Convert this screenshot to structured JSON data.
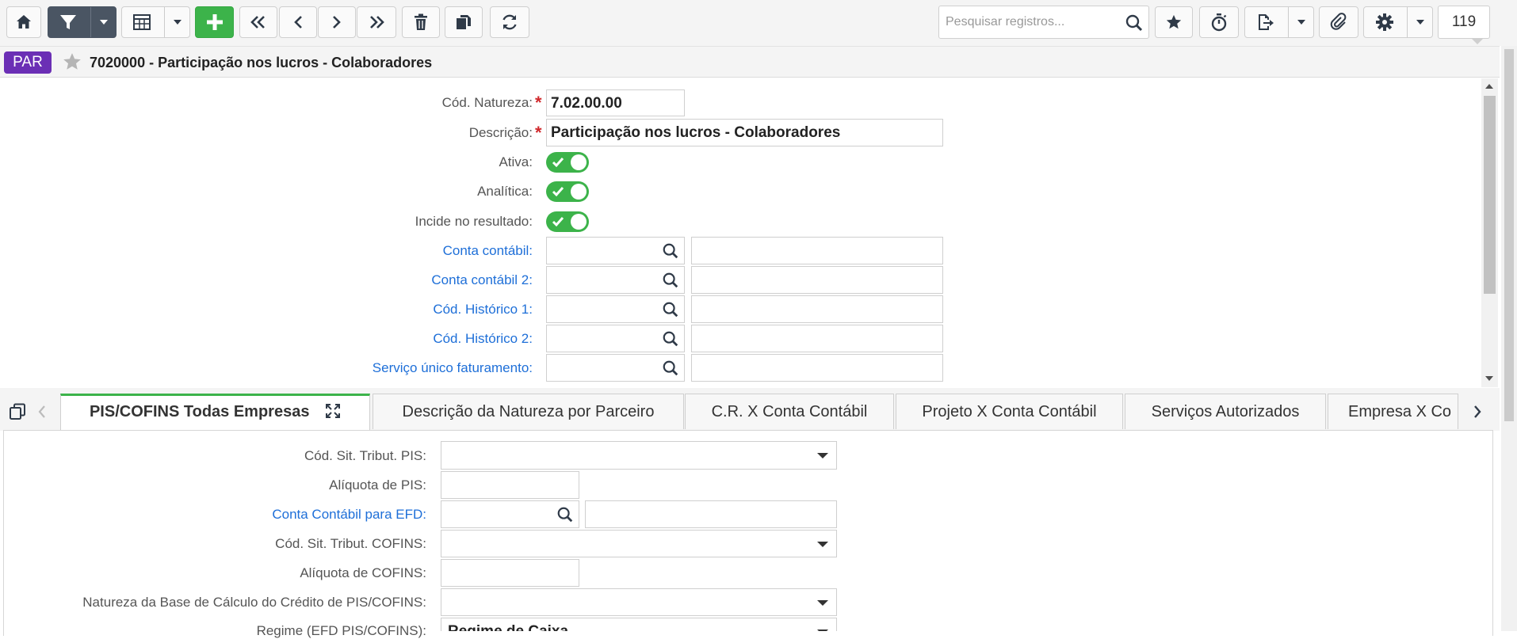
{
  "toolbar": {
    "buttons": [
      {
        "name": "home-button",
        "icon": "home-icon"
      },
      {
        "name": "filter-button",
        "icon": "filter-icon"
      },
      {
        "name": "grid-view-button",
        "icon": "grid-icon"
      },
      {
        "name": "add-button",
        "icon": "plus-icon"
      },
      {
        "name": "first-record-button",
        "icon": "double-chevron-left-icon"
      },
      {
        "name": "previous-record-button",
        "icon": "chevron-left-icon"
      },
      {
        "name": "next-record-button",
        "icon": "chevron-right-icon"
      },
      {
        "name": "last-record-button",
        "icon": "double-chevron-right-icon"
      },
      {
        "name": "delete-button",
        "icon": "trash-icon"
      },
      {
        "name": "duplicate-button",
        "icon": "copy-icon"
      },
      {
        "name": "refresh-button",
        "icon": "refresh-icon"
      },
      {
        "name": "favorite-button",
        "icon": "star-icon"
      },
      {
        "name": "timer-button",
        "icon": "stopwatch-icon"
      },
      {
        "name": "export-button",
        "icon": "export-icon"
      },
      {
        "name": "attachment-button",
        "icon": "paperclip-icon"
      },
      {
        "name": "settings-button",
        "icon": "gear-icon"
      }
    ],
    "search_placeholder": "Pesquisar registros...",
    "record_count": "119"
  },
  "header": {
    "badge": "PAR",
    "title": "7020000 - Participação nos lucros - Colaboradores"
  },
  "colors": {
    "accent_green": "#3cb34a",
    "badge_purple": "#6b2fb5",
    "link_blue": "#1e6fd8",
    "required_red": "#d0282b",
    "toolbar_dark": "#4a5563"
  },
  "form": {
    "cod_natureza": {
      "label": "Cód. Natureza:",
      "value": "7.02.00.00"
    },
    "descricao": {
      "label": "Descrição:",
      "value": "Participação nos lucros - Colaboradores"
    },
    "ativa": {
      "label": "Ativa:",
      "on": true
    },
    "analitica": {
      "label": "Analítica:",
      "on": true
    },
    "incide": {
      "label": "Incide no resultado:",
      "on": true
    },
    "conta_contabil": {
      "label": "Conta contábil:",
      "code": "",
      "description": ""
    },
    "conta_contabil_2": {
      "label": "Conta contábil 2:",
      "code": "",
      "description": ""
    },
    "cod_historico_1": {
      "label": "Cód. Histórico 1:",
      "code": "",
      "description": ""
    },
    "cod_historico_2": {
      "label": "Cód. Histórico 2:",
      "code": "",
      "description": ""
    },
    "servico_unico": {
      "label": "Serviço único faturamento:",
      "code": "",
      "description": ""
    }
  },
  "tabs": [
    {
      "label": "PIS/COFINS Todas Empresas",
      "active": true
    },
    {
      "label": "Descrição da Natureza por Parceiro",
      "active": false
    },
    {
      "label": "C.R. X Conta Contábil",
      "active": false
    },
    {
      "label": "Projeto X Conta Contábil",
      "active": false
    },
    {
      "label": "Serviços Autorizados",
      "active": false
    },
    {
      "label": "Empresa X Co",
      "active": false
    }
  ],
  "pis_cofins": {
    "cst_pis": {
      "label": "Cód. Sit. Tribut. PIS:",
      "value": ""
    },
    "aliquota_pis": {
      "label": "Alíquota de PIS:",
      "value": ""
    },
    "conta_efd": {
      "label": "Conta Contábil para EFD:",
      "code": "",
      "description": ""
    },
    "cst_cofins": {
      "label": "Cód. Sit. Tribut. COFINS:",
      "value": ""
    },
    "aliquota_cofins": {
      "label": "Alíquota de COFINS:",
      "value": ""
    },
    "natureza_base": {
      "label": "Natureza da Base de Cálculo do Crédito de PIS/COFINS:",
      "value": ""
    },
    "regime": {
      "label": "Regime (EFD PIS/COFINS):",
      "value": "Regime de Caixa"
    }
  }
}
